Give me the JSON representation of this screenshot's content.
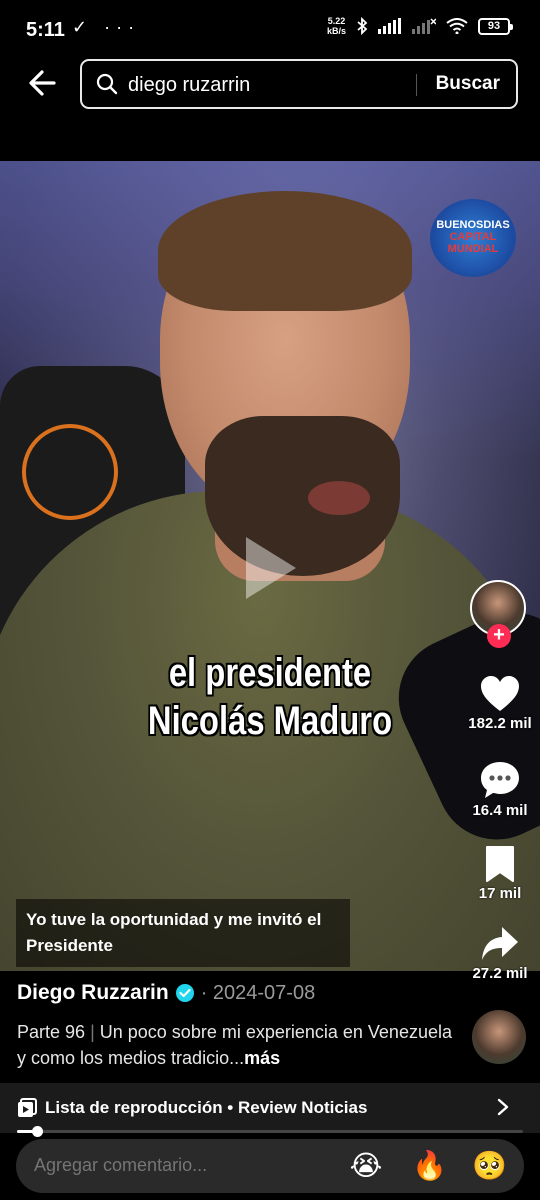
{
  "status_bar": {
    "time": "5:11",
    "left_icons": "✓ ···",
    "net_speed_value": "5.22",
    "net_speed_unit": "kB/s",
    "battery": "93"
  },
  "search": {
    "query": "diego ruzarrin",
    "submit_label": "Buscar"
  },
  "video": {
    "overlay_text_line1": "el presidente",
    "overlay_text_line2": "Nicolás Maduro",
    "channel_logo_text_top": "BUENOSDIAS",
    "channel_logo_text_bottom": "CAPITAL MUNDIAL",
    "auto_caption": "Yo tuve la oportunidad y me invitó el Presidente"
  },
  "actions": {
    "likes": "182.2 mil",
    "comments": "16.4 mil",
    "saves": "17 mil",
    "shares": "27.2 mil"
  },
  "post": {
    "author": "Diego Ruzzarin",
    "date": "· 2024-07-08",
    "part": "Parte 96",
    "separator": "|",
    "description": "Un poco sobre mi experiencia en Venezuela y como los medios tradicio...",
    "more_label": "más"
  },
  "playlist": {
    "label": "Lista de reproducción • Review Noticias",
    "progress": 0.04
  },
  "comment": {
    "placeholder": "Agregar comentario...",
    "emojis": [
      "😭",
      "🔥",
      "🥺"
    ]
  },
  "colors": {
    "accent": "#fe2c55",
    "verified": "#20d5ec"
  }
}
